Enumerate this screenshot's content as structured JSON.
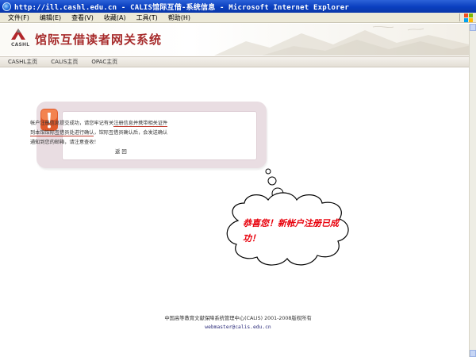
{
  "window": {
    "title": "http://ill.cashl.edu.cn - CALIS馆际互借-系统信息 - Microsoft Internet Explorer"
  },
  "menu": {
    "items": [
      "文件(F)",
      "编辑(E)",
      "查看(V)",
      "收藏(A)",
      "工具(T)",
      "帮助(H)"
    ]
  },
  "header": {
    "logo_caption": "CASHL",
    "site_title": "馆际互借读者网关系统"
  },
  "nav": {
    "links": [
      "CASHL主页",
      "CALIS主页",
      "OPAC主页"
    ]
  },
  "message": {
    "line1_a": "帐户注册信息提交成功，请您牢记有关",
    "line1_b": "注册信息",
    "line1_c": "并携带相关证件",
    "line2_a": "到本馆馆际互借员处进行确认",
    "line2_b": "，馆际互借员确认后，会发送确认",
    "line3": "通知到您的邮箱，请注意查收！",
    "back": "返 回"
  },
  "bubble": {
    "text": "恭喜您！新帐户注册已成功！"
  },
  "footer": {
    "copyright": "中国高等教育文献保障系统管理中心(CALIS) 2001-2008版权所有",
    "email": "webmaster@calis.edu.cn"
  },
  "colors": {
    "titlebar": "#0a3fbf",
    "site_title": "#a72c2c",
    "bubble_text": "#e8000b",
    "panel": "#e9dde2"
  }
}
